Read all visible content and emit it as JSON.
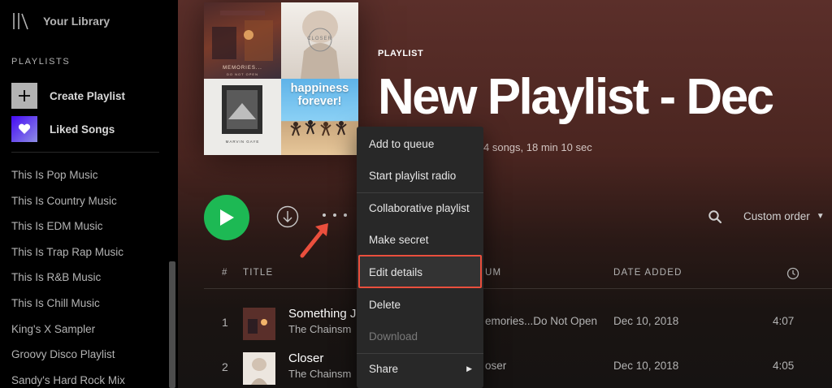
{
  "sidebar": {
    "library_label": "Your Library",
    "section_title": "PLAYLISTS",
    "create_playlist": "Create Playlist",
    "liked_songs": "Liked Songs",
    "playlists": [
      "This Is Pop Music",
      "This Is Country Music",
      "This Is EDM Music",
      "This Is Trap Rap Music",
      "This Is R&B Music",
      "This Is Chill Music",
      "King's X Sampler",
      "Groovy Disco Playlist",
      "Sandy's Hard Rock Mix"
    ]
  },
  "header": {
    "type_label": "PLAYLIST",
    "title": "New Playlist - Dec",
    "meta": "4 songs, 18 min 10 sec"
  },
  "cover": {
    "tile1_text": "MEMORIES...",
    "tile1_sub": "DO NOT OPEN",
    "tile2_text": "CLOSER",
    "tile3_text": "MARVIN GAYE",
    "tile4_line1": "happiness",
    "tile4_line2": "forever!"
  },
  "controls": {
    "sort_label": "Custom order"
  },
  "table": {
    "columns": {
      "number": "#",
      "title": "TITLE",
      "album": "UM",
      "date_added": "DATE ADDED"
    },
    "rows": [
      {
        "num": "1",
        "song": "Something J",
        "artist": "The Chainsm",
        "album": "emories...Do Not Open",
        "date": "Dec 10, 2018",
        "duration": "4:07"
      },
      {
        "num": "2",
        "song": "Closer",
        "artist": "The Chainsm",
        "album": "oser",
        "date": "Dec 10, 2018",
        "duration": "4:05"
      }
    ]
  },
  "context_menu": {
    "items": [
      {
        "label": "Add to queue",
        "enabled": true
      },
      {
        "label": "Start playlist radio",
        "enabled": true
      },
      {
        "label": "Collaborative playlist",
        "enabled": true
      },
      {
        "label": "Make secret",
        "enabled": true
      },
      {
        "label": "Edit details",
        "enabled": true,
        "highlighted": true
      },
      {
        "label": "Delete",
        "enabled": true
      },
      {
        "label": "Download",
        "enabled": false
      },
      {
        "label": "Share",
        "enabled": true,
        "has_submenu": true
      }
    ]
  },
  "colors": {
    "accent_green": "#1db954",
    "highlight_red": "#ea4f3d",
    "menu_bg": "#282828"
  }
}
